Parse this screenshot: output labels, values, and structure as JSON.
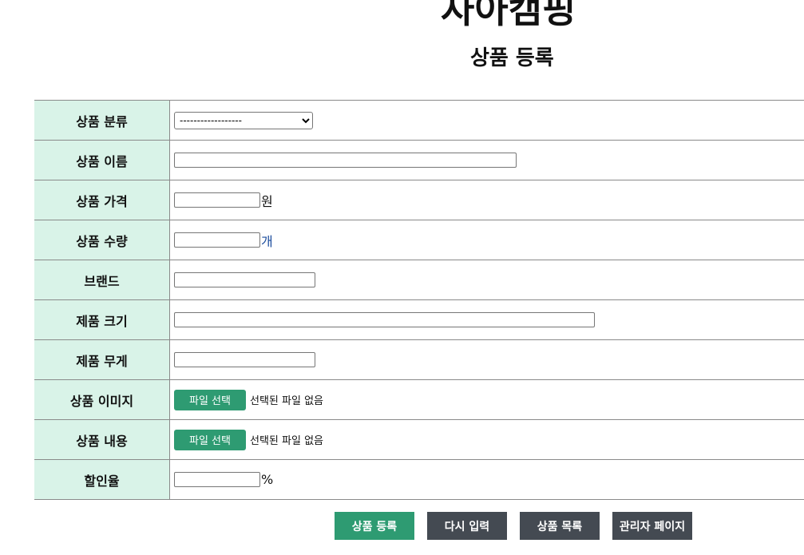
{
  "header": {
    "site_title": "자아캠핑",
    "page_title": "상품 등록"
  },
  "form": {
    "category": {
      "label": "상품 분류",
      "selected": "------------------"
    },
    "name": {
      "label": "상품 이름",
      "value": ""
    },
    "price": {
      "label": "상품 가격",
      "value": "",
      "unit": "원"
    },
    "quantity": {
      "label": "상품 수량",
      "value": "",
      "unit": "개"
    },
    "brand": {
      "label": "브랜드",
      "value": ""
    },
    "size": {
      "label": "제품 크기",
      "value": ""
    },
    "weight": {
      "label": "제품 무게",
      "value": ""
    },
    "image": {
      "label": "상품 이미지",
      "button": "파일 선택",
      "status": "선택된 파일 없음"
    },
    "content": {
      "label": "상품 내용",
      "button": "파일 선택",
      "status": "선택된 파일 없음"
    },
    "discount": {
      "label": "할인율",
      "value": "",
      "unit": "%"
    }
  },
  "actions": {
    "register": "상품 등록",
    "reset": "다시 입력",
    "list": "상품 목록",
    "admin": "관리자 페이지"
  },
  "colors": {
    "label_bg": "#d9f3e8",
    "primary_green": "#2e9b72",
    "dark_button": "#444a52",
    "border": "#8a8a8a"
  }
}
